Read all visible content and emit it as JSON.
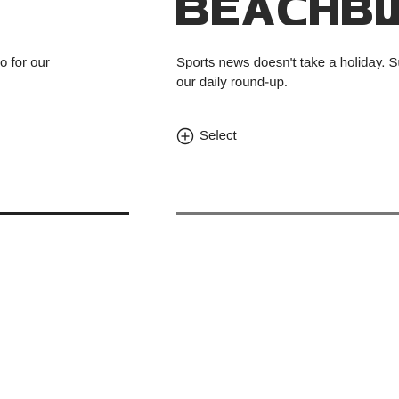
{
  "previous_card": {
    "description_fragment": "o for our"
  },
  "newsletter": {
    "logo_icon": "beach-bulletin-logo",
    "description_line1": "Sports news doesn't take a holiday. Subsc",
    "description_line2": "our daily round-up.",
    "select_icon": "plus-circle-icon",
    "select_label": "Select"
  },
  "colors": {
    "text": "#222222",
    "rule_left": "#222222",
    "rule_main": "#777777",
    "logo": "#2b2b2b"
  }
}
